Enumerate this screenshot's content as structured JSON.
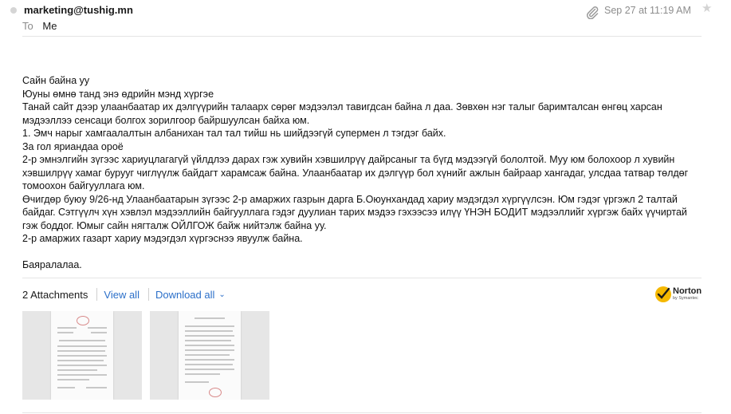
{
  "header": {
    "sender": "marketing@tushig.mn",
    "to_label": "To",
    "to_value": "Me",
    "date": "Sep 27 at 11:19 AM",
    "icons": {
      "attachment": "paperclip-icon",
      "star": "star-icon",
      "unread": "unread-dot"
    }
  },
  "body": {
    "greeting": "Сайн байна уу",
    "line1": "Юуны өмнө танд энэ өдрийн мэнд хүргэе",
    "line2": "Танай сайт дээр улаанбаатар их дэлгүүрийн талаарх сөрөг мэдээлэл тавигдсан байна л даа. Зөвхөн нэг талыг баримталсан өнгөц харсан мэдээллээ сенсаци болгох зорилгоор байршуулсан байха юм.",
    "line3": "1. Эмч нарыг хамгаалалтын албанихан тал тал тийш нь шийдээгүй супермен л тэгдэг байх.",
    "line4": "За гол яриандаа ороё",
    "line5": "2-р эмнэлгийн зүгээс хариуцлагагүй үйлдлээ дарах гэж хувийн хэвшилрүү дайрсаныг та бүгд мэдээгүй бололтой. Муу юм болохоор л хувийн хэвшилрүү хамаг бурууг чиглүүлж байдагт харамсаж байна. Улаанбаатар их дэлгүүр бол хүнийг ажлын байраар хангадаг, улсдаа татвар төлдөг томоохон байгууллага юм.",
    "line6": "Өчигдөр буюу 9/26-нд Улаанбаатарын зүгээс 2-р амаржих газрын дарга Б.Оюунхандад хариу мэдэгдэл хүргүүлсэн. Юм гэдэг үргэжл 2 талтай байдаг. Сэтгүүлч хүн хэвлэл мэдээллийн байгууллага гэдэг дуулиан тарих мэдээ гэхээсээ илүү ҮНЭН БОДИТ мэдээллийг хүргэж байх үүчиртай гэж боддог. Юмыг сайн нягталж ОЙЛГОЖ байж нийтэлж байна уу.",
    "line7": "2-р амаржих газарт хариу мэдэгдэл хүргэснээ явуулж байна.",
    "closing": "Баяралалаа."
  },
  "attachments": {
    "count_label": "2 Attachments",
    "view_all": "View all",
    "download_all": "Download all",
    "badge_name": "Norton",
    "badge_sub": "by Symantec",
    "items": [
      {
        "type": "document-thumbnail"
      },
      {
        "type": "document-thumbnail"
      }
    ]
  },
  "colors": {
    "link": "#2b6fc9",
    "muted": "#8d8d8d",
    "divider": "#e5e5e5",
    "norton_yellow": "#f5b800"
  }
}
